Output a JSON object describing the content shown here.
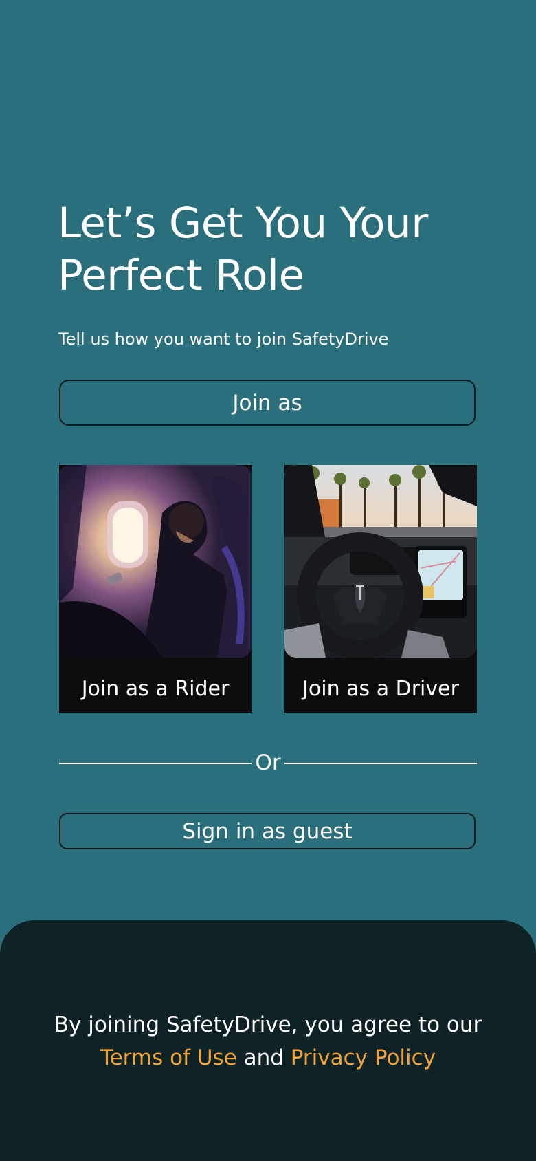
{
  "header": {
    "title": "Let’s Get You Your Perfect Role",
    "subtitle": "Tell us how you want to join SafetyDrive"
  },
  "join_as_label": "Join as",
  "roles": [
    {
      "label": "Join as a Rider",
      "image": "passenger-on-airplane-photo"
    },
    {
      "label": "Join as a Driver",
      "image": "tesla-steering-wheel-photo"
    }
  ],
  "divider_text": "Or",
  "guest_label": "Sign in as guest",
  "footer": {
    "prefix": "By joining SafetyDrive, you agree to our",
    "terms_label": "Terms of Use",
    "conjunction": "and",
    "privacy_label": "Privacy Policy"
  },
  "colors": {
    "background": "#2b6f7c",
    "footer_background": "#0f2226",
    "link": "#f0a43a",
    "text": "#ffffff"
  }
}
